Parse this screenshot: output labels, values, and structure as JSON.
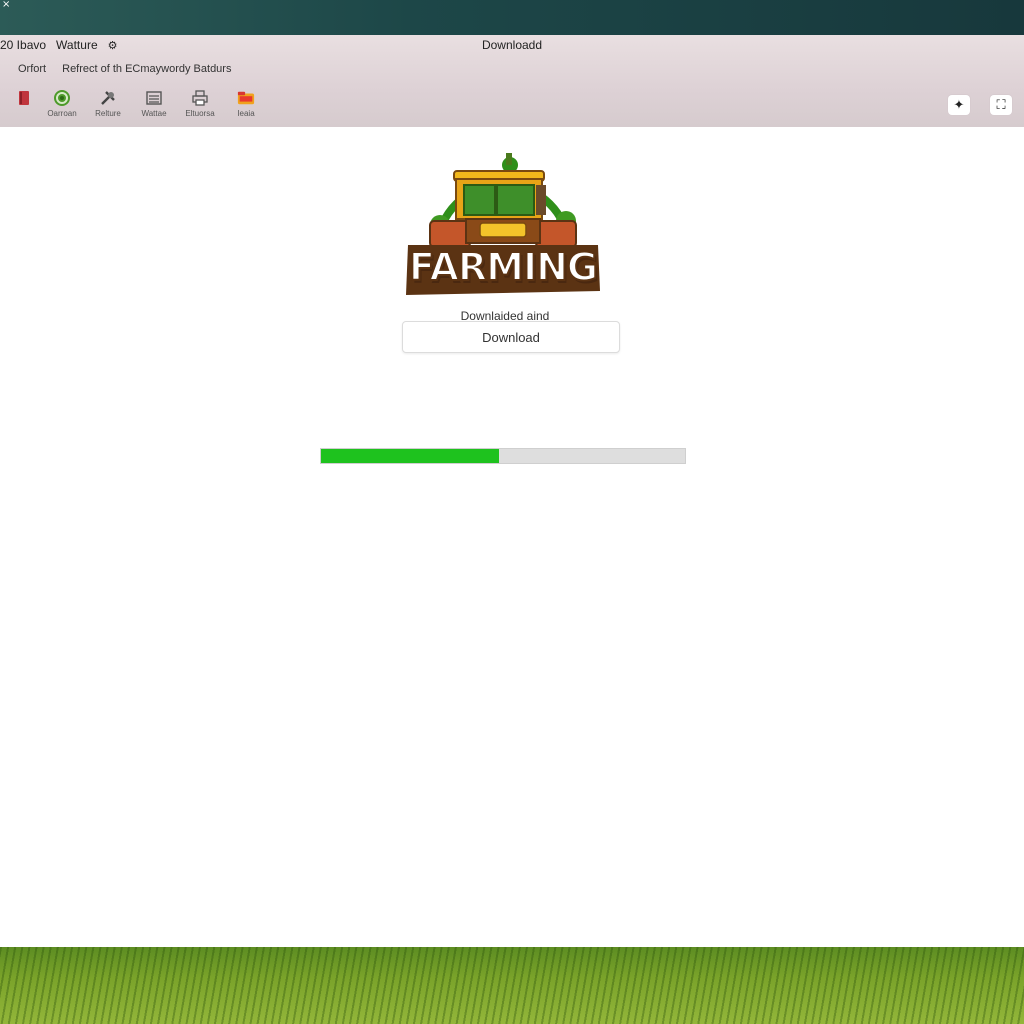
{
  "window": {
    "title": "Downloadd",
    "title_left_num": "20 Ibavo",
    "title_left_label": "Watture",
    "close_glyph": "×"
  },
  "menu": {
    "items": [
      "Orfort",
      "Refrect of th ECmaywordy Batdurs"
    ]
  },
  "toolbar": {
    "items": [
      {
        "icon": "red-book-icon",
        "label": ""
      },
      {
        "icon": "green-gear-icon",
        "label": "Oarroan"
      },
      {
        "icon": "tools-icon",
        "label": "Relture"
      },
      {
        "icon": "list-icon",
        "label": "Wattae"
      },
      {
        "icon": "printer-icon",
        "label": "Eltuorsa"
      },
      {
        "icon": "folder-icon",
        "label": "Ieaia"
      }
    ]
  },
  "logo": {
    "text": "FARMING"
  },
  "main": {
    "status_text": "Downlaided aind",
    "button_label": "Download",
    "progress_fraction": 0.49
  },
  "colors": {
    "progress_fill": "#1ec21e",
    "progress_track": "#dedede",
    "logo_brown": "#5b3313",
    "logo_green": "#2f8f1a",
    "tractor_yellow": "#f2b81b"
  }
}
